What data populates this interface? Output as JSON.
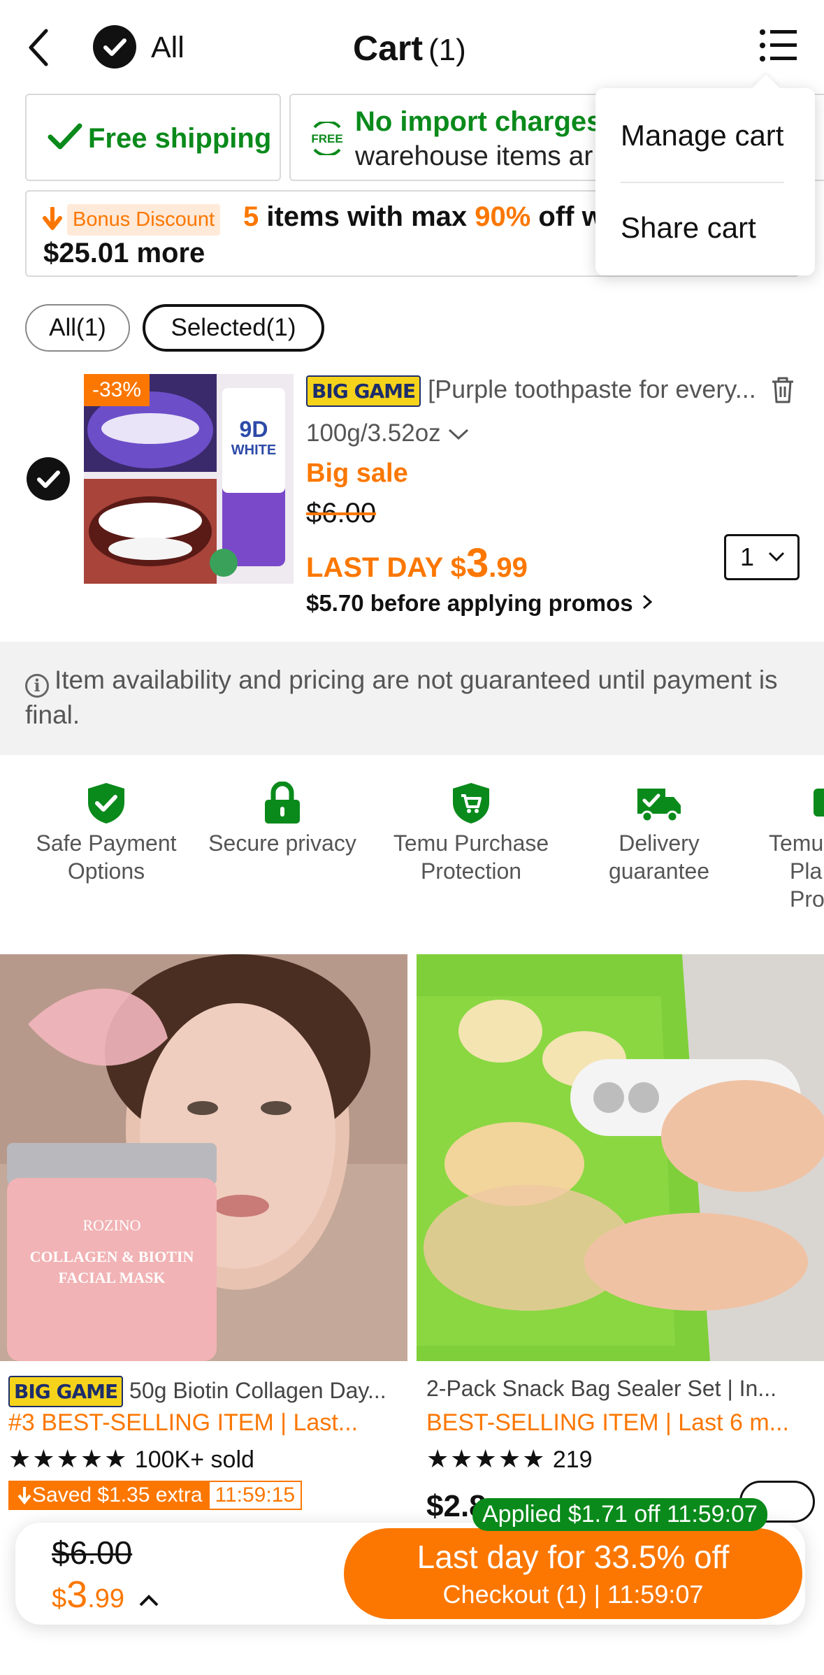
{
  "header": {
    "all_label": "All",
    "title": "Cart",
    "count": "(1)"
  },
  "badges": {
    "free_shipping": "Free shipping",
    "free_icon_text": "FREE",
    "import_title": "No import charges",
    "import_sub": "warehouse items ar"
  },
  "bonus": {
    "tag": "Bonus Discount",
    "count": "5",
    "text1": " items with max ",
    "percent": "90%",
    "text2": " off w",
    "more": "$25.01 more"
  },
  "dropdown": {
    "items": [
      "Manage cart",
      "Share cart"
    ]
  },
  "filters": {
    "all": "All(1)",
    "selected": "Selected(1)"
  },
  "cart_item": {
    "discount": "-33%",
    "badge": "BIG GAME",
    "title": "[Purple toothpaste for every...",
    "variant": "100g/3.52oz",
    "sale_label": "Big sale",
    "old_price": "$6.00",
    "last_day": "LAST DAY ",
    "price_symbol": "$",
    "price_int": "3",
    "price_dec": ".99",
    "quantity": "1",
    "before_promos": "$5.70 before applying promos"
  },
  "notice": "Item availability and pricing are not guaranteed until payment is final.",
  "trust": [
    {
      "line1": "Safe Payment",
      "line2": "Options",
      "icon": "shield-check-icon"
    },
    {
      "line1": "Secure privacy",
      "line2": "",
      "icon": "lock-icon"
    },
    {
      "line1": "Temu Purchase",
      "line2": "Protection",
      "icon": "shield-cart-icon"
    },
    {
      "line1": "Delivery",
      "line2": "guarantee",
      "icon": "truck-check-icon"
    },
    {
      "line1": "Temu",
      "line2": "Pla",
      "line3": "Pro",
      "icon": "price-icon"
    }
  ],
  "products": [
    {
      "badge": "BIG GAME",
      "title": "50g Biotin Collagen Day...",
      "sub": "#3 BEST-SELLING ITEM | Last...",
      "stars": "★★★★★",
      "rating_text": "100K+ sold",
      "saved_label": "Saved $1.35 extra",
      "saved_timer": "11:59:15",
      "jar_brand": "ROZINO",
      "jar_line1": "COLLAGEN & BIOTIN",
      "jar_line2": "FACIAL MASK"
    },
    {
      "title": "2-Pack Snack Bag Sealer Set | In...",
      "sub": "BEST-SELLING ITEM | Last 6 m...",
      "stars": "★★★★★",
      "rating_text": "219",
      "price": "$2.8",
      "applied": "Applied $1.71 off 11:59:07"
    }
  ],
  "bottom_bar": {
    "old_price": "$6.00",
    "price_symbol": "$",
    "price_int": "3",
    "price_dec": ".99",
    "checkout_line1": "Last day for 33.5% off",
    "checkout_line2": "Checkout (1) | 11:59:07"
  },
  "colors": {
    "accent": "#fb7701",
    "green": "#0a8a1b",
    "badge_yellow": "#f6d31b"
  }
}
